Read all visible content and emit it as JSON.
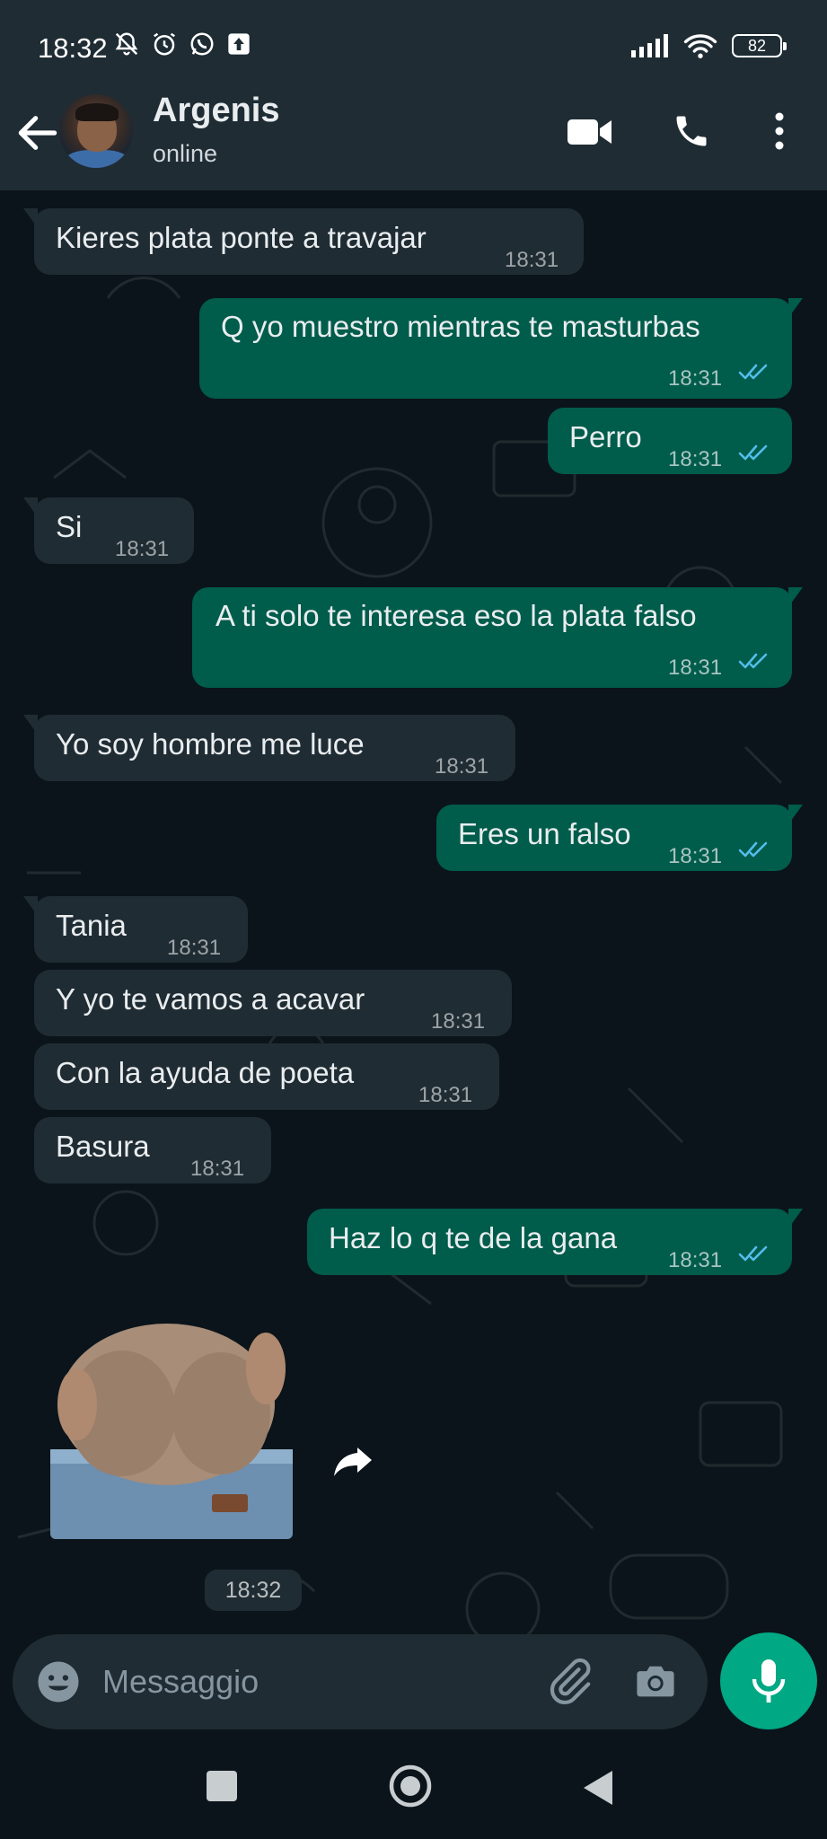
{
  "status_bar": {
    "time": "18:32",
    "battery": "82"
  },
  "header": {
    "contact_name": "Argenis",
    "contact_status": "online"
  },
  "messages": [
    {
      "direction": "in",
      "text": "Kieres plata ponte a travajar",
      "time": "18:31"
    },
    {
      "direction": "out",
      "text": "Q yo muestro mientras te masturbas",
      "time": "18:31",
      "read": true
    },
    {
      "direction": "out",
      "text": "Perro",
      "time": "18:31",
      "read": true
    },
    {
      "direction": "in",
      "text": "Si",
      "time": "18:31"
    },
    {
      "direction": "out",
      "text": "A ti solo te interesa eso la plata falso",
      "time": "18:31",
      "read": true
    },
    {
      "direction": "in",
      "text": "Yo soy hombre me luce",
      "time": "18:31"
    },
    {
      "direction": "out",
      "text": "Eres un falso",
      "time": "18:31",
      "read": true
    },
    {
      "direction": "in",
      "text": "Tania",
      "time": "18:31"
    },
    {
      "direction": "in",
      "text": "Y yo te vamos a acavar",
      "time": "18:31"
    },
    {
      "direction": "in",
      "text": "Con la ayuda de poeta",
      "time": "18:31"
    },
    {
      "direction": "in",
      "text": "Basura",
      "time": "18:31"
    },
    {
      "direction": "out",
      "text": "Haz lo q te de la gana",
      "time": "18:31",
      "read": true
    }
  ],
  "sticker_message": {
    "direction": "in",
    "time": "18:32"
  },
  "composer": {
    "placeholder": "Messaggio"
  },
  "colors": {
    "header_bg": "#1f2c34",
    "chat_bg": "#0b141a",
    "incoming_bubble": "#202c33",
    "outgoing_bubble": "#005c4b",
    "read_ticks": "#53bdeb",
    "mic_button": "#00a884"
  },
  "icons": {
    "status_left": [
      "mute-bell-icon",
      "alarm-icon",
      "whatsapp-icon",
      "upload-icon"
    ],
    "status_right": [
      "signal-icon",
      "wifi-icon",
      "battery-icon"
    ],
    "header": [
      "back-arrow-icon",
      "video-call-icon",
      "voice-call-icon",
      "more-options-icon"
    ],
    "composer": [
      "emoji-icon",
      "attach-clip-icon",
      "camera-icon",
      "microphone-icon"
    ],
    "navigation": [
      "recents-square-icon",
      "home-circle-icon",
      "back-triangle-icon"
    ]
  }
}
